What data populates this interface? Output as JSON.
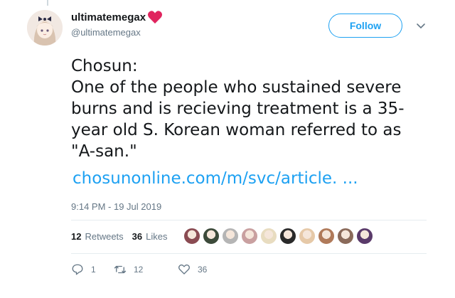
{
  "user": {
    "display_name": "ultimatemegax",
    "handle": "@ultimatemegax"
  },
  "follow_button": {
    "label": "Follow"
  },
  "tweet": {
    "lines": [
      "Chosun:",
      "One of the people who sustained severe",
      "burns and is recieving treatment is a 35-",
      "year old S. Korean woman referred to as",
      "\"A-san.\""
    ],
    "link": "chosunonline.com/m/svc/article. ...",
    "timestamp": "9:14 PM - 19 Jul 2019"
  },
  "stats": {
    "retweets_count": "12",
    "retweets_label": "Retweets",
    "likes_count": "36",
    "likes_label": "Likes"
  },
  "liker_avatars": [
    "#8a4b52",
    "#3c4a3a",
    "#b5b5b5",
    "#c9a0a0",
    "#e8dcc0",
    "#2a2a2a",
    "#e6c9a8",
    "#b07a5a",
    "#8a6a5a",
    "#5a3a6a"
  ],
  "actions": {
    "reply_count": "1",
    "retweet_count": "12",
    "like_count": "36"
  },
  "colors": {
    "accent": "#1da1f2",
    "heart": "#e0245e",
    "muted": "#657786"
  }
}
